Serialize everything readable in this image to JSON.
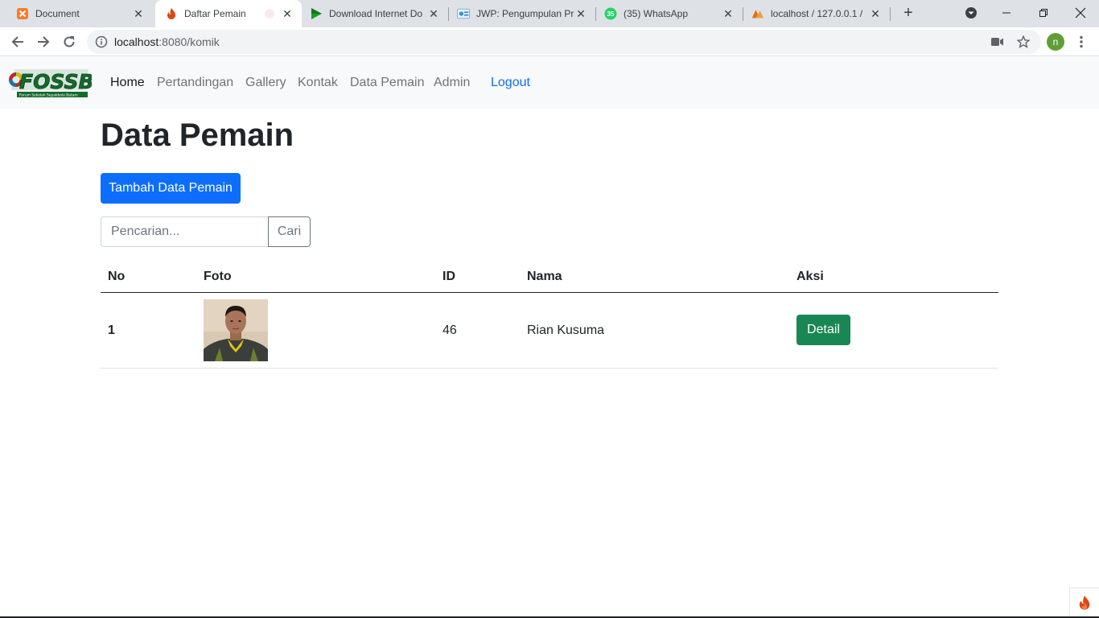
{
  "browser": {
    "tabs": [
      {
        "title": "Document",
        "icon": "xampp-icon",
        "active": false
      },
      {
        "title": "Daftar Pemain",
        "icon": "codeigniter-flame-icon",
        "active": true
      },
      {
        "title": "Download Internet Do",
        "icon": "play-icon",
        "active": false
      },
      {
        "title": "JWP: Pengumpulan Pr",
        "icon": "jwp-icon",
        "active": false
      },
      {
        "title": "(35) WhatsApp",
        "icon": "whatsapp-icon",
        "active": false
      },
      {
        "title": "localhost / 127.0.0.1 /",
        "icon": "phpmyadmin-icon",
        "active": false
      }
    ],
    "url_host": "localhost",
    "url_rest": ":8080/komik",
    "profile_initial": "n",
    "whatsapp_badge": "35"
  },
  "navbar": {
    "brand": "FOSSBAT",
    "brand_sub": "Forum Sekolah Sepakbola Batam",
    "links": [
      "Home",
      "Pertandingan",
      "Gallery",
      "Kontak",
      "Data Pemain",
      "Admin",
      "Logout"
    ]
  },
  "main": {
    "title": "Data Pemain",
    "add_button": "Tambah Data Pemain",
    "search_placeholder": "Pencarian...",
    "search_button": "Cari",
    "table": {
      "headers": [
        "No",
        "Foto",
        "ID",
        "Nama",
        "Aksi"
      ],
      "rows": [
        {
          "no": "1",
          "id": "46",
          "nama": "Rian Kusuma",
          "action": "Detail"
        }
      ]
    }
  },
  "colors": {
    "primary": "#0d6efd",
    "success": "#198754",
    "navbar_bg": "#f8f9fa"
  }
}
